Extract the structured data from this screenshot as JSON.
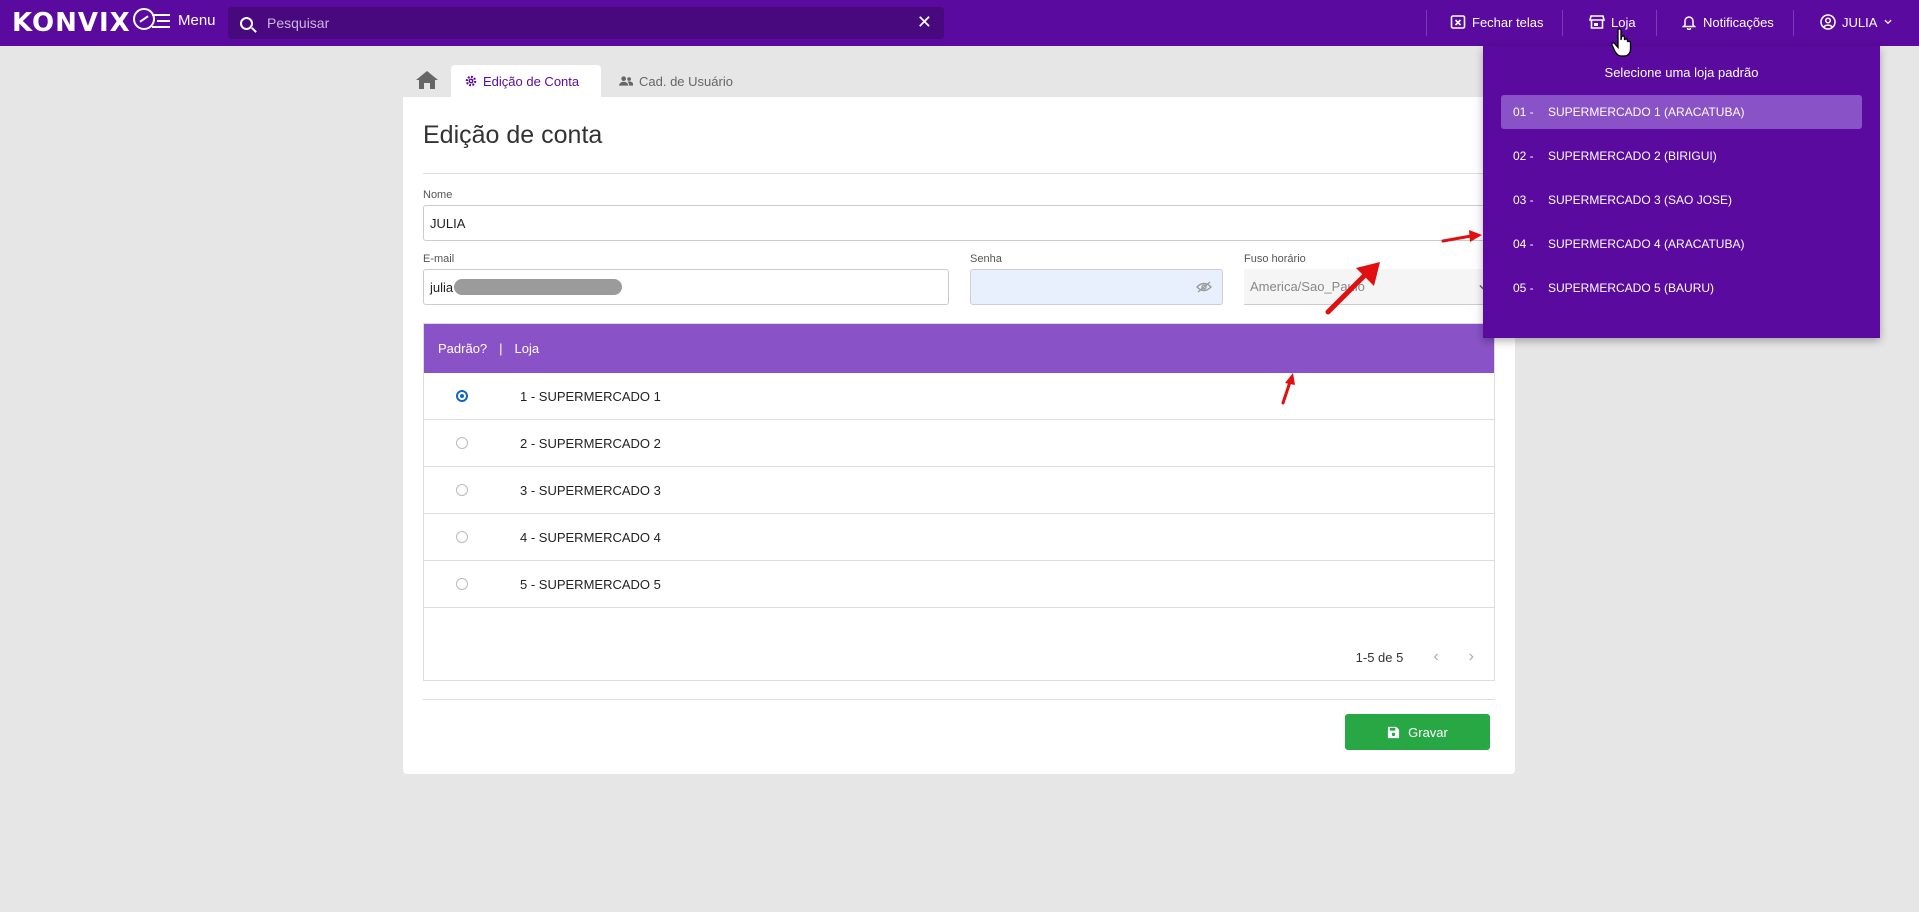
{
  "topbar": {
    "logo": "KONVIX",
    "menu_label": "Menu",
    "search_placeholder": "Pesquisar",
    "fechar_label": "Fechar telas",
    "loja_label": "Loja",
    "notif_label": "Notificações",
    "user_label": "JULIA"
  },
  "tabs": {
    "active": "Edição de Conta",
    "inactive": "Cad. de Usuário"
  },
  "form": {
    "title": "Edição de conta",
    "nome_label": "Nome",
    "nome_value": "JULIA",
    "email_label": "E-mail",
    "email_value": "julia",
    "senha_label": "Senha",
    "fuso_label": "Fuso horário",
    "fuso_value": "America/Sao_Paulo"
  },
  "table": {
    "header_padrao": "Padrão?",
    "header_sep": "|",
    "header_loja": "Loja",
    "rows": [
      {
        "label": "1 - SUPERMERCADO 1",
        "selected": true
      },
      {
        "label": "2 - SUPERMERCADO 2",
        "selected": false
      },
      {
        "label": "3 - SUPERMERCADO 3",
        "selected": false
      },
      {
        "label": "4 - SUPERMERCADO 4",
        "selected": false
      },
      {
        "label": "5 - SUPERMERCADO 5",
        "selected": false
      }
    ],
    "pagination": "1-5 de 5"
  },
  "save_label": "Gravar",
  "dropdown": {
    "title": "Selecione uma loja padrão",
    "items": [
      {
        "num": "01 -",
        "name": "SUPERMERCADO 1 (ARACATUBA)"
      },
      {
        "num": "02 -",
        "name": "SUPERMERCADO 2 (BIRIGUI)"
      },
      {
        "num": "03 -",
        "name": "SUPERMERCADO 3 (SAO JOSE)"
      },
      {
        "num": "04 -",
        "name": "SUPERMERCADO 4 (ARACATUBA)"
      },
      {
        "num": "05 -",
        "name": "SUPERMERCADO 5 (BAURU)"
      }
    ]
  },
  "colors": {
    "brand": "#5a0a9e",
    "table_header": "#8a52c7",
    "save": "#28a745",
    "annotation": "#e01010"
  }
}
